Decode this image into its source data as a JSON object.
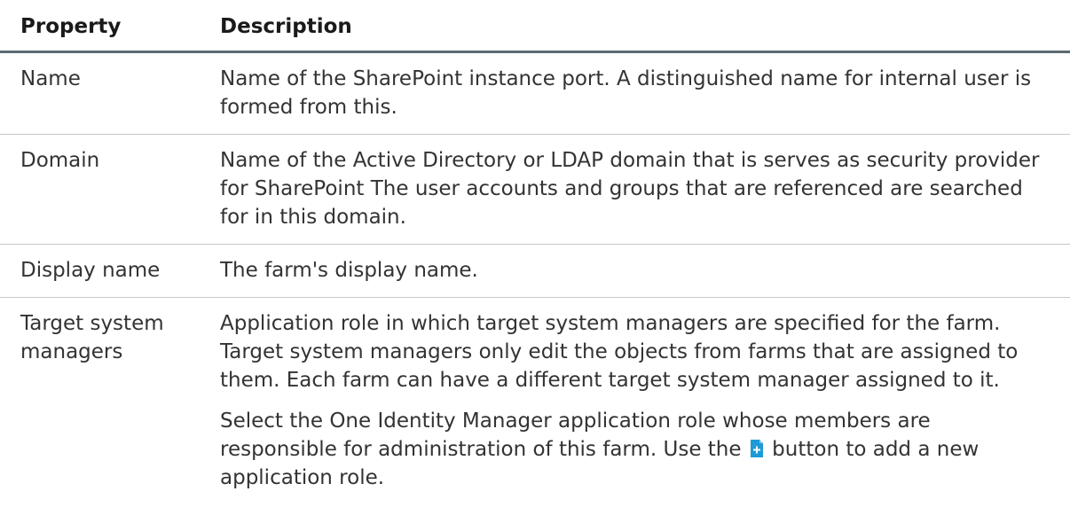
{
  "table": {
    "headers": {
      "property": "Property",
      "description": "Description"
    },
    "rows": [
      {
        "property": "Name",
        "description": [
          "Name of the SharePoint instance port. A distinguished name for internal user is formed from this."
        ]
      },
      {
        "property": "Domain",
        "description": [
          "Name of the Active Directory or LDAP domain that is serves as security provider for SharePoint The user accounts and groups that are referenced are searched for in this domain."
        ]
      },
      {
        "property": "Display name",
        "description": [
          "The farm's display name."
        ]
      },
      {
        "property": "Target system managers",
        "description": [
          "Application role in which target system managers are specified for the farm. Target system managers only edit the objects from farms that are assigned to them. Each farm can have a different target system manager assigned to it."
        ],
        "description_extra": {
          "before_icon": "Select the One Identity Manager application role whose members are responsible for administration of this farm. Use the",
          "icon": "add-document-icon",
          "after_icon": "button to add a new application role."
        }
      }
    ]
  },
  "colors": {
    "header_rule": "#5a6a72",
    "row_rule": "#c8c8c8",
    "icon_fill": "#1e9ad6"
  }
}
